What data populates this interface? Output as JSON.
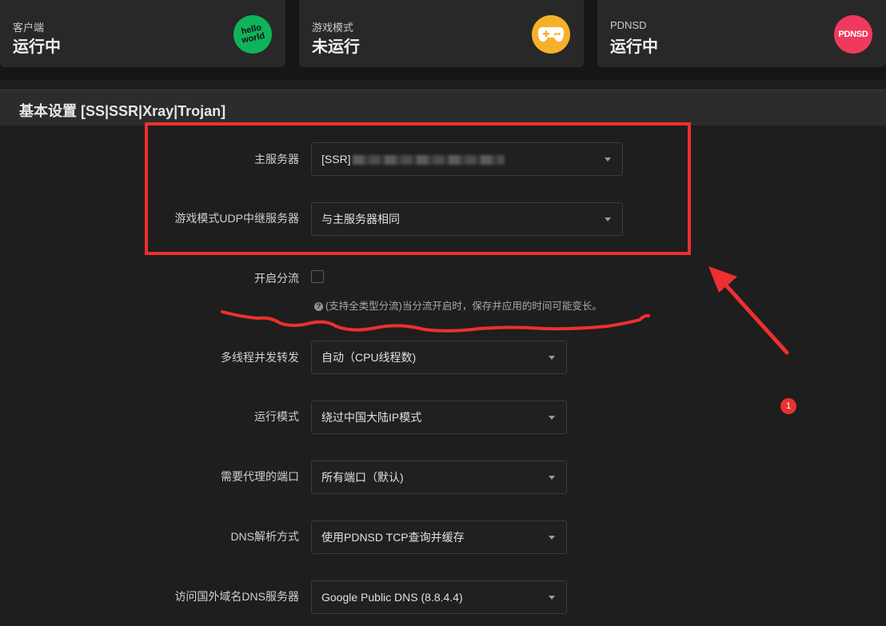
{
  "status_cards": [
    {
      "label": "客户端",
      "value": "运行中",
      "icon": "hello-world-icon"
    },
    {
      "label": "游戏模式",
      "value": "未运行",
      "icon": "gamepad-icon"
    },
    {
      "label": "PDNSD",
      "value": "运行中",
      "icon": "pdnsd-icon",
      "icon_text": "PDNSD"
    }
  ],
  "hello_icon": {
    "line1": "hello",
    "line2": "world"
  },
  "section": {
    "title": "基本设置 [SS|SSR|Xray|Trojan]"
  },
  "fields": {
    "main_server": {
      "label": "主服务器",
      "value": "[SSR]"
    },
    "udp_relay": {
      "label": "游戏模式UDP中继服务器",
      "value": "与主服务器相同"
    },
    "split": {
      "label": "开启分流",
      "help": "(支持全类型分流)当分流开启时，保存并应用的时间可能变长。",
      "checked": false
    },
    "threads": {
      "label": "多线程并发转发",
      "value": "自动（CPU线程数)"
    },
    "run_mode": {
      "label": "运行模式",
      "value": "绕过中国大陆IP模式"
    },
    "ports": {
      "label": "需要代理的端口",
      "value": "所有端口（默认)"
    },
    "dns_mode": {
      "label": "DNS解析方式",
      "value": "使用PDNSD TCP查询并缓存"
    },
    "dns_server": {
      "label": "访问国外域名DNS服务器",
      "value": "Google Public DNS (8.8.4.4)"
    }
  },
  "notification": {
    "count": "1"
  },
  "colors": {
    "annotation_red": "#ee2f2f",
    "hello_green": "#0fb35a",
    "game_yellow": "#f7b02a",
    "pdnsd_pink": "#ef3a5d"
  }
}
